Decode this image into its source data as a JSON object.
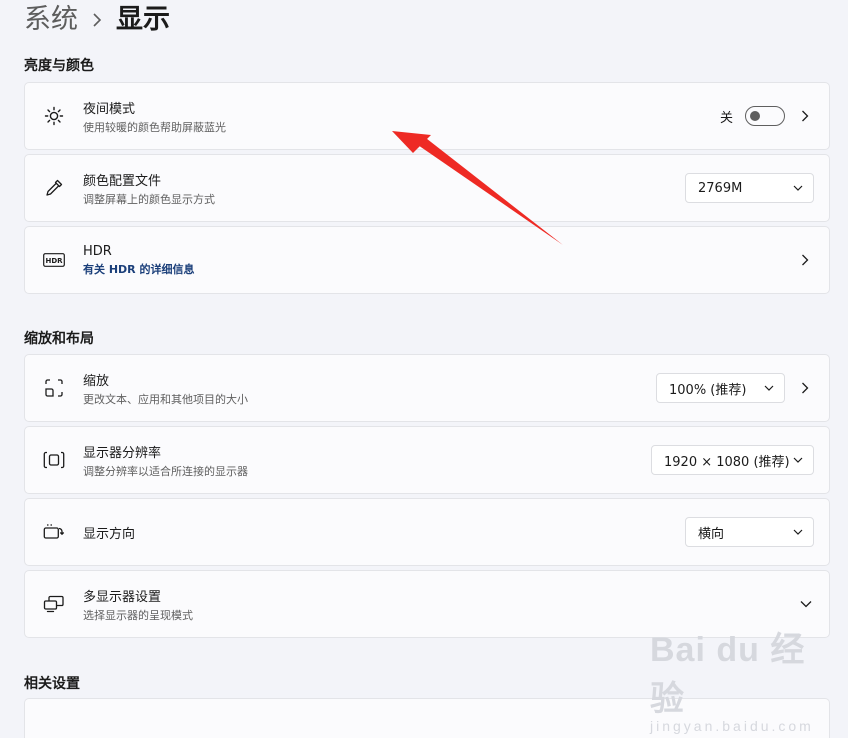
{
  "breadcrumb": {
    "root": "系统",
    "current": "显示"
  },
  "sections": {
    "brightness_color": "亮度与颜色",
    "scale_layout": "缩放和布局",
    "related": "相关设置"
  },
  "night_mode": {
    "title": "夜间模式",
    "subtitle": "使用较暖的颜色帮助屏蔽蓝光",
    "state_label": "关",
    "enabled": false
  },
  "color_profile": {
    "title": "颜色配置文件",
    "subtitle": "调整屏幕上的颜色显示方式",
    "value": "2769M"
  },
  "hdr": {
    "title": "HDR",
    "link": "有关 HDR 的详细信息",
    "icon_text": "HDR"
  },
  "scale": {
    "title": "缩放",
    "subtitle": "更改文本、应用和其他项目的大小",
    "value": "100% (推荐)"
  },
  "resolution": {
    "title": "显示器分辨率",
    "subtitle": "调整分辨率以适合所连接的显示器",
    "value": "1920 × 1080 (推荐)"
  },
  "orientation": {
    "title": "显示方向",
    "value": "横向"
  },
  "multi_display": {
    "title": "多显示器设置",
    "subtitle": "选择显示器的呈现模式"
  },
  "watermark": {
    "main": "Bai du 经验",
    "sub": "jingyan.baidu.com"
  },
  "colors": {
    "annotation_arrow": "#ee2a24",
    "link": "#1b3f7a"
  }
}
